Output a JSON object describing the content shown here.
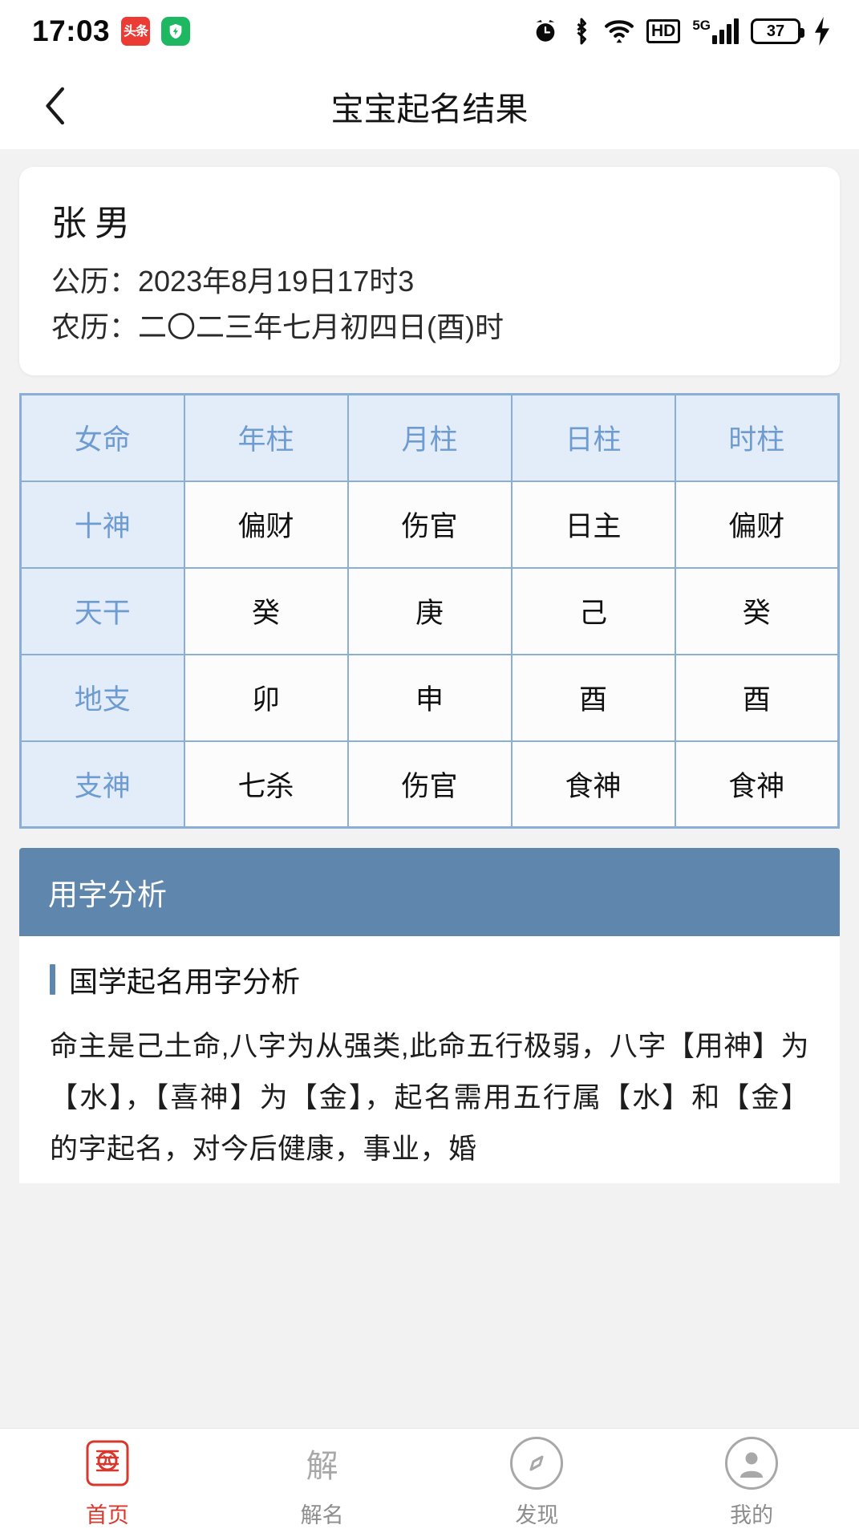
{
  "statusbar": {
    "time": "17:03",
    "app_badge_line1": "头",
    "app_badge_line2": "条",
    "battery_level": "37",
    "hd_label": "HD",
    "network_label": "5G"
  },
  "navbar": {
    "title": "宝宝起名结果"
  },
  "info_card": {
    "surname": "张",
    "gender": "男",
    "solar_label": "公历：",
    "solar_value": "2023年8月19日17时3",
    "lunar_label": "农历：",
    "lunar_value": "二〇二三年七月初四日(酉)时"
  },
  "bazi_table": {
    "columns": [
      "女命",
      "年柱",
      "月柱",
      "日柱",
      "时柱"
    ],
    "rows": [
      {
        "label": "十神",
        "cells": [
          "偏财",
          "伤官",
          "日主",
          "偏财"
        ]
      },
      {
        "label": "天干",
        "cells": [
          "癸",
          "庚",
          "己",
          "癸"
        ]
      },
      {
        "label": "地支",
        "cells": [
          "卯",
          "申",
          "酉",
          "酉"
        ]
      },
      {
        "label": "支神",
        "cells": [
          "七杀",
          "伤官",
          "食神",
          "食神"
        ]
      }
    ]
  },
  "analysis": {
    "header": "用字分析",
    "sub_title": "国学起名用字分析",
    "paragraph": "命主是己土命,八字为从强类,此命五行极弱，八字【用神】为【水】，【喜神】为【金】，起名需用五行属【水】和【金】 的字起名，对今后健康，事业，婚"
  },
  "tabbar": {
    "items": [
      {
        "label": "首页",
        "icon": "home-seal-icon",
        "glyph": "印",
        "active": true
      },
      {
        "label": "解名",
        "icon": "interpret-icon",
        "glyph": "解",
        "active": false
      },
      {
        "label": "发现",
        "icon": "discover-icon",
        "glyph": "",
        "active": false
      },
      {
        "label": "我的",
        "icon": "profile-icon",
        "glyph": "",
        "active": false
      }
    ]
  },
  "colors": {
    "accent_blue": "#5f87ad",
    "table_border": "#8aaed6",
    "table_header_bg": "#e3edf9",
    "active_tab": "#d8372c"
  }
}
